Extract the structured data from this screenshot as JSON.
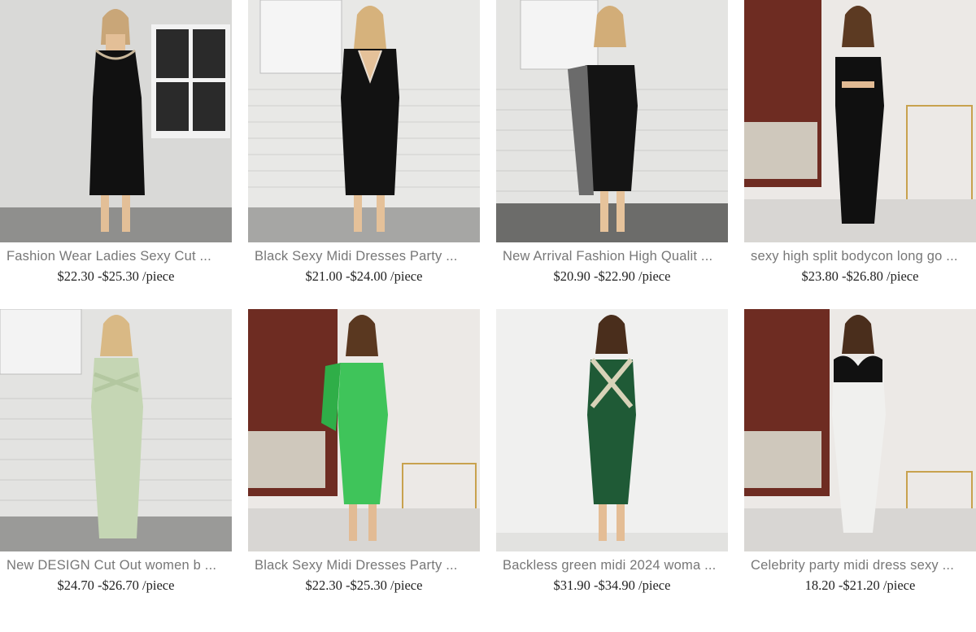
{
  "products": [
    {
      "title": "Fashion Wear Ladies Sexy Cut ...",
      "price": "$22.30 -$25.30 /piece",
      "dress_color": "#111111",
      "trim_color": "#c9b79a",
      "image": "model-photo"
    },
    {
      "title": "Black Sexy Midi Dresses Party ...",
      "price": "$21.00 -$24.00 /piece",
      "dress_color": "#121212",
      "trim_color": "#e8ddd0",
      "image": "model-photo"
    },
    {
      "title": "New Arrival Fashion High Qualit ...",
      "price": "$20.90 -$22.90 /piece",
      "dress_color": "#141414",
      "trim_color": "#6b6b6b",
      "image": "model-photo"
    },
    {
      "title": "sexy high split bodycon long go ...",
      "price": "$23.80 -$26.80 /piece",
      "dress_color": "#101010",
      "trim_color": "#101010",
      "image": "model-photo"
    },
    {
      "title": "New DESIGN Cut Out women b ...",
      "price": "$24.70 -$26.70 /piece",
      "dress_color": "#c5d6b4",
      "trim_color": "#b3c7a0",
      "image": "model-photo"
    },
    {
      "title": "Black Sexy Midi Dresses Party ...",
      "price": "$22.30 -$25.30 /piece",
      "dress_color": "#3fc45a",
      "trim_color": "#2fae48",
      "image": "model-photo"
    },
    {
      "title": "Backless green midi 2024 woma ...",
      "price": "$31.90 -$34.90 /piece",
      "dress_color": "#1f5a36",
      "trim_color": "#d8d2b8",
      "image": "model-photo"
    },
    {
      "title": "Celebrity party midi dress sexy ...",
      "price": "18.20 -$21.20 /piece",
      "dress_color": "#f0f0ee",
      "trim_color": "#111111",
      "image": "model-photo"
    }
  ]
}
